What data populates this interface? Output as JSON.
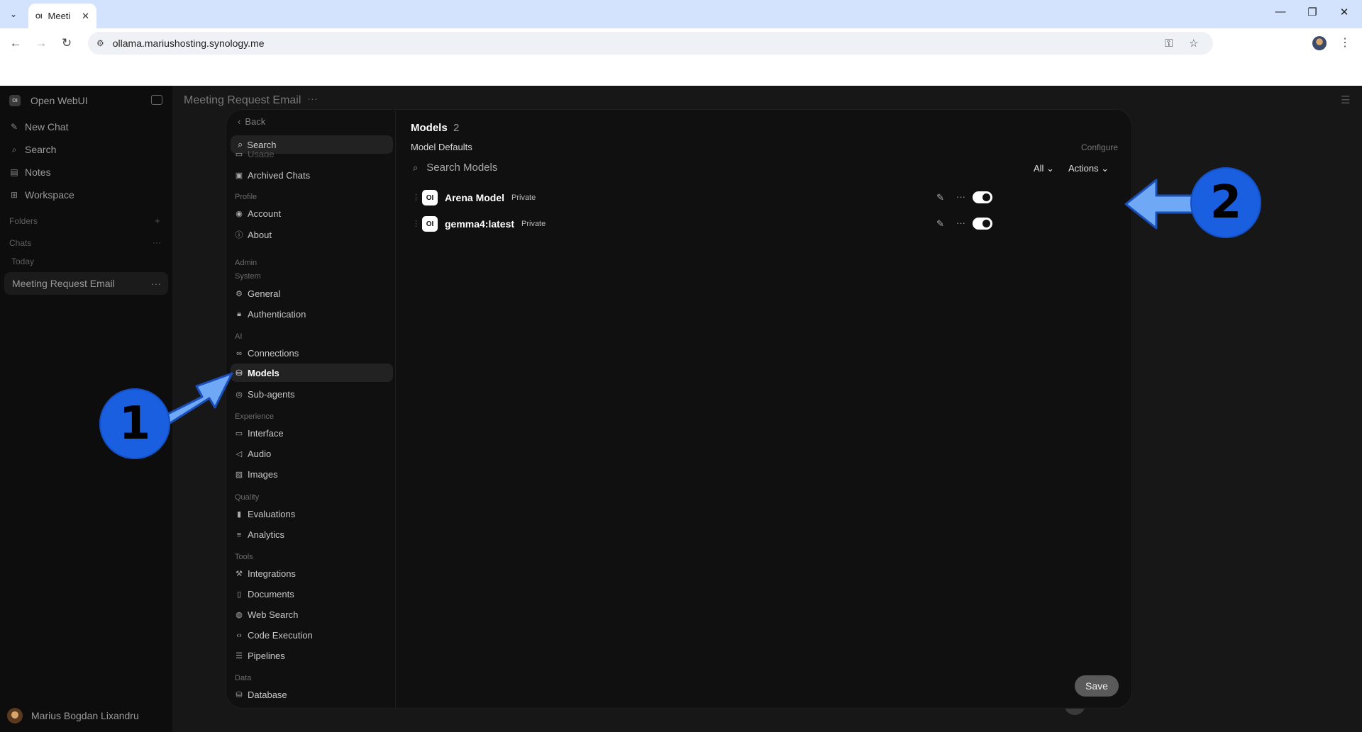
{
  "browser": {
    "tab_title": "Meeti",
    "tab_favicon": "OI",
    "url": "ollama.mariushosting.synology.me"
  },
  "sidebar": {
    "app_name": "Open WebUI",
    "logo": "OI",
    "items": [
      {
        "label": "New Chat",
        "icon": "pencil-icon"
      },
      {
        "label": "Search",
        "icon": "search-icon"
      },
      {
        "label": "Notes",
        "icon": "note-icon"
      },
      {
        "label": "Workspace",
        "icon": "grid-icon"
      }
    ],
    "folders_label": "Folders",
    "chats_label": "Chats",
    "today_label": "Today",
    "chat_item": "Meeting Request Email",
    "user_name": "Marius Bogdan Lixandru"
  },
  "main": {
    "chat_title": "Meeting Request Email"
  },
  "modal": {
    "back_label": "Back",
    "search_label": "Search",
    "partial_item": "Usage",
    "nav": {
      "archived": "Archived Chats",
      "profile_group": "Profile",
      "account": "Account",
      "about": "About",
      "admin_group": "Admin",
      "system_group": "System",
      "general": "General",
      "authentication": "Authentication",
      "ai_group": "AI",
      "connections": "Connections",
      "models": "Models",
      "subagents": "Sub-agents",
      "experience_group": "Experience",
      "interface": "Interface",
      "audio": "Audio",
      "images": "Images",
      "quality_group": "Quality",
      "evaluations": "Evaluations",
      "analytics": "Analytics",
      "tools_group": "Tools",
      "integrations": "Integrations",
      "documents": "Documents",
      "web_search": "Web Search",
      "code_execution": "Code Execution",
      "pipelines": "Pipelines",
      "data_group": "Data",
      "database": "Database"
    },
    "content": {
      "title": "Models",
      "count": "2",
      "defaults_label": "Model Defaults",
      "configure_label": "Configure",
      "search_placeholder": "Search Models",
      "filter_label": "All",
      "actions_label": "Actions",
      "models": [
        {
          "name": "Arena Model",
          "tag": "Private",
          "enabled": true
        },
        {
          "name": "gemma4:latest",
          "tag": "Private",
          "enabled": true
        }
      ],
      "save_label": "Save"
    }
  },
  "annotations": {
    "badge1": "1",
    "badge2": "2",
    "color": "#1a5fe0",
    "arrow_color": "#6fa8f5"
  }
}
